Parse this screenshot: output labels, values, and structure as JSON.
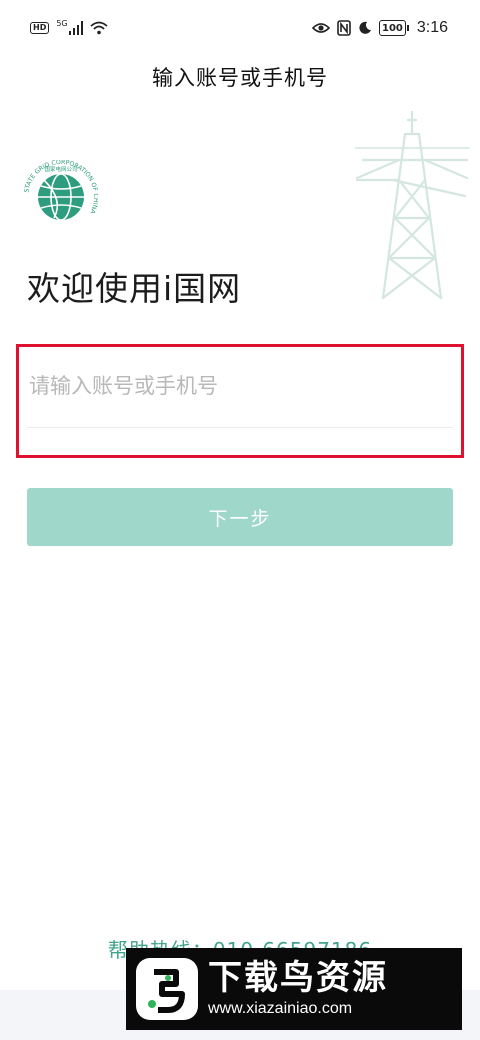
{
  "status_bar": {
    "hd": "HD",
    "network": "5G",
    "battery": "100",
    "time": "3:16",
    "icons": [
      "hd-icon",
      "signal-icon",
      "wifi-icon",
      "eye-icon",
      "nfc-icon",
      "moon-icon",
      "battery-icon"
    ]
  },
  "header": {
    "title": "输入账号或手机号"
  },
  "logo": {
    "arc_text": "国家电网公司",
    "ring_text": "STATE GRID CORPORATION OF CHINA"
  },
  "welcome": "欢迎使用i国网",
  "account_input": {
    "value": "",
    "placeholder": "请输入账号或手机号"
  },
  "next_button": {
    "label": "下一步"
  },
  "hotline": {
    "text": "帮助热线：010-66597186"
  },
  "watermark": {
    "title": "下载鸟资源",
    "url": "www.xiazainiao.com"
  },
  "colors": {
    "accent": "#41a48e",
    "button_disabled": "#9fd7cb",
    "highlight_border": "#e0102f",
    "placeholder": "#b8b8b8"
  }
}
